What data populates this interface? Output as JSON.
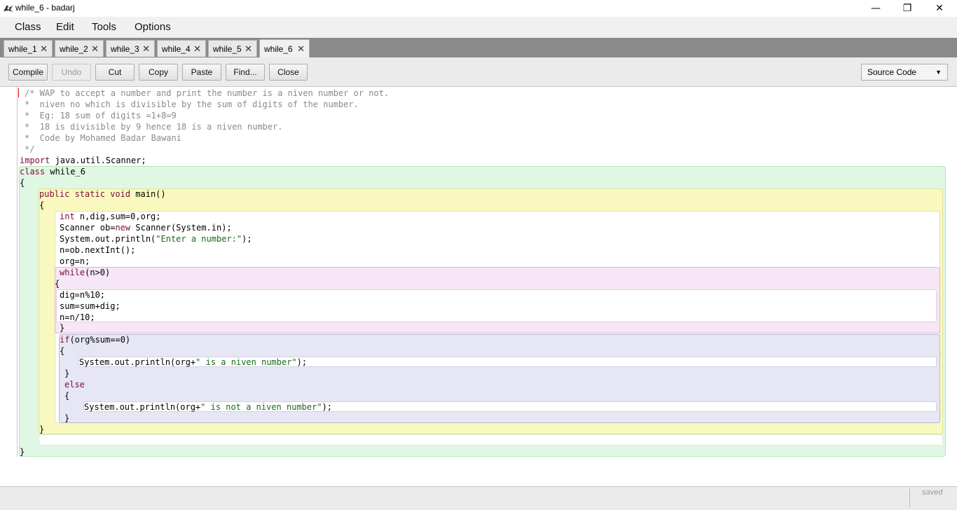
{
  "window": {
    "title": "while_6 - badarj",
    "controls": {
      "minimize": "—",
      "maximize": "❐",
      "close": "✕"
    }
  },
  "menu": [
    "Class",
    "Edit",
    "Tools",
    "Options"
  ],
  "tabs": [
    {
      "label": "while_1",
      "active": false
    },
    {
      "label": "while_2",
      "active": false
    },
    {
      "label": "while_3",
      "active": false
    },
    {
      "label": "while_4",
      "active": false
    },
    {
      "label": "while_5",
      "active": false
    },
    {
      "label": "while_6",
      "active": true
    }
  ],
  "tab_close_glyph": "✕",
  "toolbar": {
    "compile": "Compile",
    "undo": "Undo",
    "cut": "Cut",
    "copy": "Copy",
    "paste": "Paste",
    "find": "Find...",
    "close": "Close",
    "view_select": "Source Code",
    "caret": "▼"
  },
  "code": {
    "c1": "/* WAP to accept a number and print the number is a niven number or not.",
    "c2": "*  niven no which is divisible by the sum of digits of the number.",
    "c3": "*  Eg: 18 sum of digits =1+8=9",
    "c4": "*  18 is divisible by 9 hence 18 is a niven number.",
    "c5": "*  Code by Mohamed Badar Bawani",
    "c6": "*/",
    "import_kw": "import",
    "import_rest": " java.util.Scanner;",
    "class_kw": "class",
    "class_rest": " while_6",
    "open_brace": "{",
    "close_brace": "}",
    "main_kw": "public static void",
    "main_rest": " main()",
    "int_kw": "int",
    "int_rest": " n,dig,sum=0,org;",
    "scanner_a": "Scanner ob=",
    "scanner_kw": "new",
    "scanner_b": " Scanner(System.in);",
    "println1_a": "System.out.println(",
    "println1_str": "\"Enter a number:\"",
    "println1_b": ");",
    "read": "n=ob.nextInt();",
    "assign": "org=n;",
    "while_kw": "while",
    "while_rest": "(n>0)",
    "dig": "dig=n%10;",
    "sum": "sum=sum+dig;",
    "div": "n=n/10;",
    "if_kw": "if",
    "if_rest": "(org%sum==0)",
    "println2_a": "System.out.println(org+",
    "println2_str": "\" is a niven number\"",
    "println2_b": ");",
    "else_kw": "else",
    "println3_a": "System.out.println(org+",
    "println3_str": "\" is not a niven number\"",
    "println3_b": ");"
  },
  "status": "saved",
  "colors": {
    "class_scope": "#e0f7e3",
    "method_scope": "#f9f9bf",
    "body_scope": "#ffffff",
    "loop_scope": "#f6e6f6",
    "if_scope": "#e6e6f4",
    "keyword": "#7a0d3a",
    "string": "#1a6b1a",
    "comment": "#8a8a8a"
  }
}
